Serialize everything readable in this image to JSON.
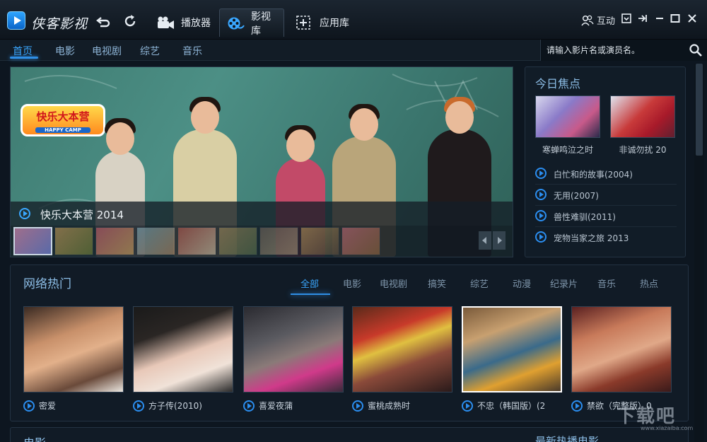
{
  "app": {
    "title": "侠客影视",
    "nav_tabs": [
      {
        "label": "播放器",
        "icon": "film-camera-icon"
      },
      {
        "label": "影视库",
        "icon": "film-reel-icon",
        "active": true
      },
      {
        "label": "应用库",
        "icon": "plus-box-icon"
      }
    ],
    "interact_label": "互动",
    "window_controls": [
      "skin-icon",
      "pin-icon",
      "minimize-icon",
      "maximize-icon",
      "close-icon"
    ]
  },
  "subnav": {
    "items": [
      "首页",
      "电影",
      "电视剧",
      "综艺",
      "音乐"
    ],
    "active_index": 0
  },
  "search": {
    "placeholder": "请输入影片名或演员名。"
  },
  "hero": {
    "title": "快乐大本营 2014",
    "show_logo_text": "快乐大本营",
    "show_logo_sub": "HAPPY CAMP",
    "thumbnail_count": 9,
    "active_thumbnail": 0
  },
  "today_focus": {
    "heading": "今日焦点",
    "posters": [
      {
        "title": "寒蝉鸣泣之时"
      },
      {
        "title": "非诚勿扰 20"
      }
    ],
    "list": [
      "白忙和的故事(2004)",
      "无用(2007)",
      "兽性难驯(2011)",
      "宠物当家之旅 2013"
    ]
  },
  "hot": {
    "heading": "网络热门",
    "categories": [
      "全部",
      "电影",
      "电视剧",
      "搞笑",
      "综艺",
      "动漫",
      "纪录片",
      "音乐",
      "热点"
    ],
    "active_category": 0,
    "films": [
      {
        "title": "密爱"
      },
      {
        "title": "方子传(2010)"
      },
      {
        "title": "喜爱夜蒲"
      },
      {
        "title": "蜜桃成熟时"
      },
      {
        "title": "不忠（韩国版）(2",
        "selected": true
      },
      {
        "title": "禁欲（完整版）0"
      }
    ]
  },
  "bottom": {
    "left_title": "电影",
    "right_title": "最新热播电影"
  },
  "watermark": {
    "text": "下载吧",
    "sub": "www.xiazaiba.com"
  },
  "colors": {
    "accent": "#2f8fe6",
    "background": "#0d1620",
    "panel": "#111b26"
  }
}
